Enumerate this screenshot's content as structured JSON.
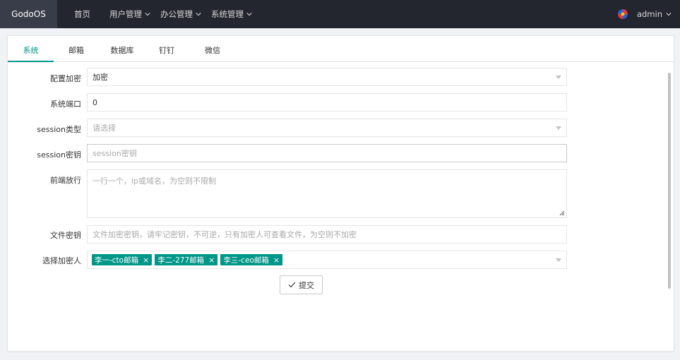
{
  "app": {
    "logo": "GodoOS"
  },
  "nav": {
    "items": [
      {
        "label": "首页",
        "has_menu": false
      },
      {
        "label": "用户管理",
        "has_menu": true
      },
      {
        "label": "办公管理",
        "has_menu": true
      },
      {
        "label": "系统管理",
        "has_menu": true
      }
    ],
    "user": "admin"
  },
  "tabs": [
    "系统",
    "邮箱",
    "数据库",
    "钉钉",
    "微信"
  ],
  "active_tab": "系统",
  "form": {
    "encrypt": {
      "label": "配置加密",
      "value": "加密"
    },
    "port": {
      "label": "系统端口",
      "value": "0"
    },
    "session_type": {
      "label": "session类型",
      "placeholder": "请选择"
    },
    "session_key": {
      "label": "session密钥",
      "placeholder": "session密钥"
    },
    "frontend": {
      "label": "前端放行",
      "placeholder": "一行一个，ip或域名，为空则不限制"
    },
    "file_key": {
      "label": "文件密钥",
      "placeholder": "文件加密密钥，请牢记密钥，不可逆，只有加密人可查看文件，为空则不加密"
    },
    "encrypt_users": {
      "label": "选择加密人",
      "tags": [
        "李一-cto邮箱",
        "李二-277邮箱",
        "李三-ceo邮箱"
      ],
      "remove_glyph": "×"
    },
    "submit": "提交"
  },
  "colors": {
    "topbar": "#23262e",
    "accent": "#009688"
  }
}
